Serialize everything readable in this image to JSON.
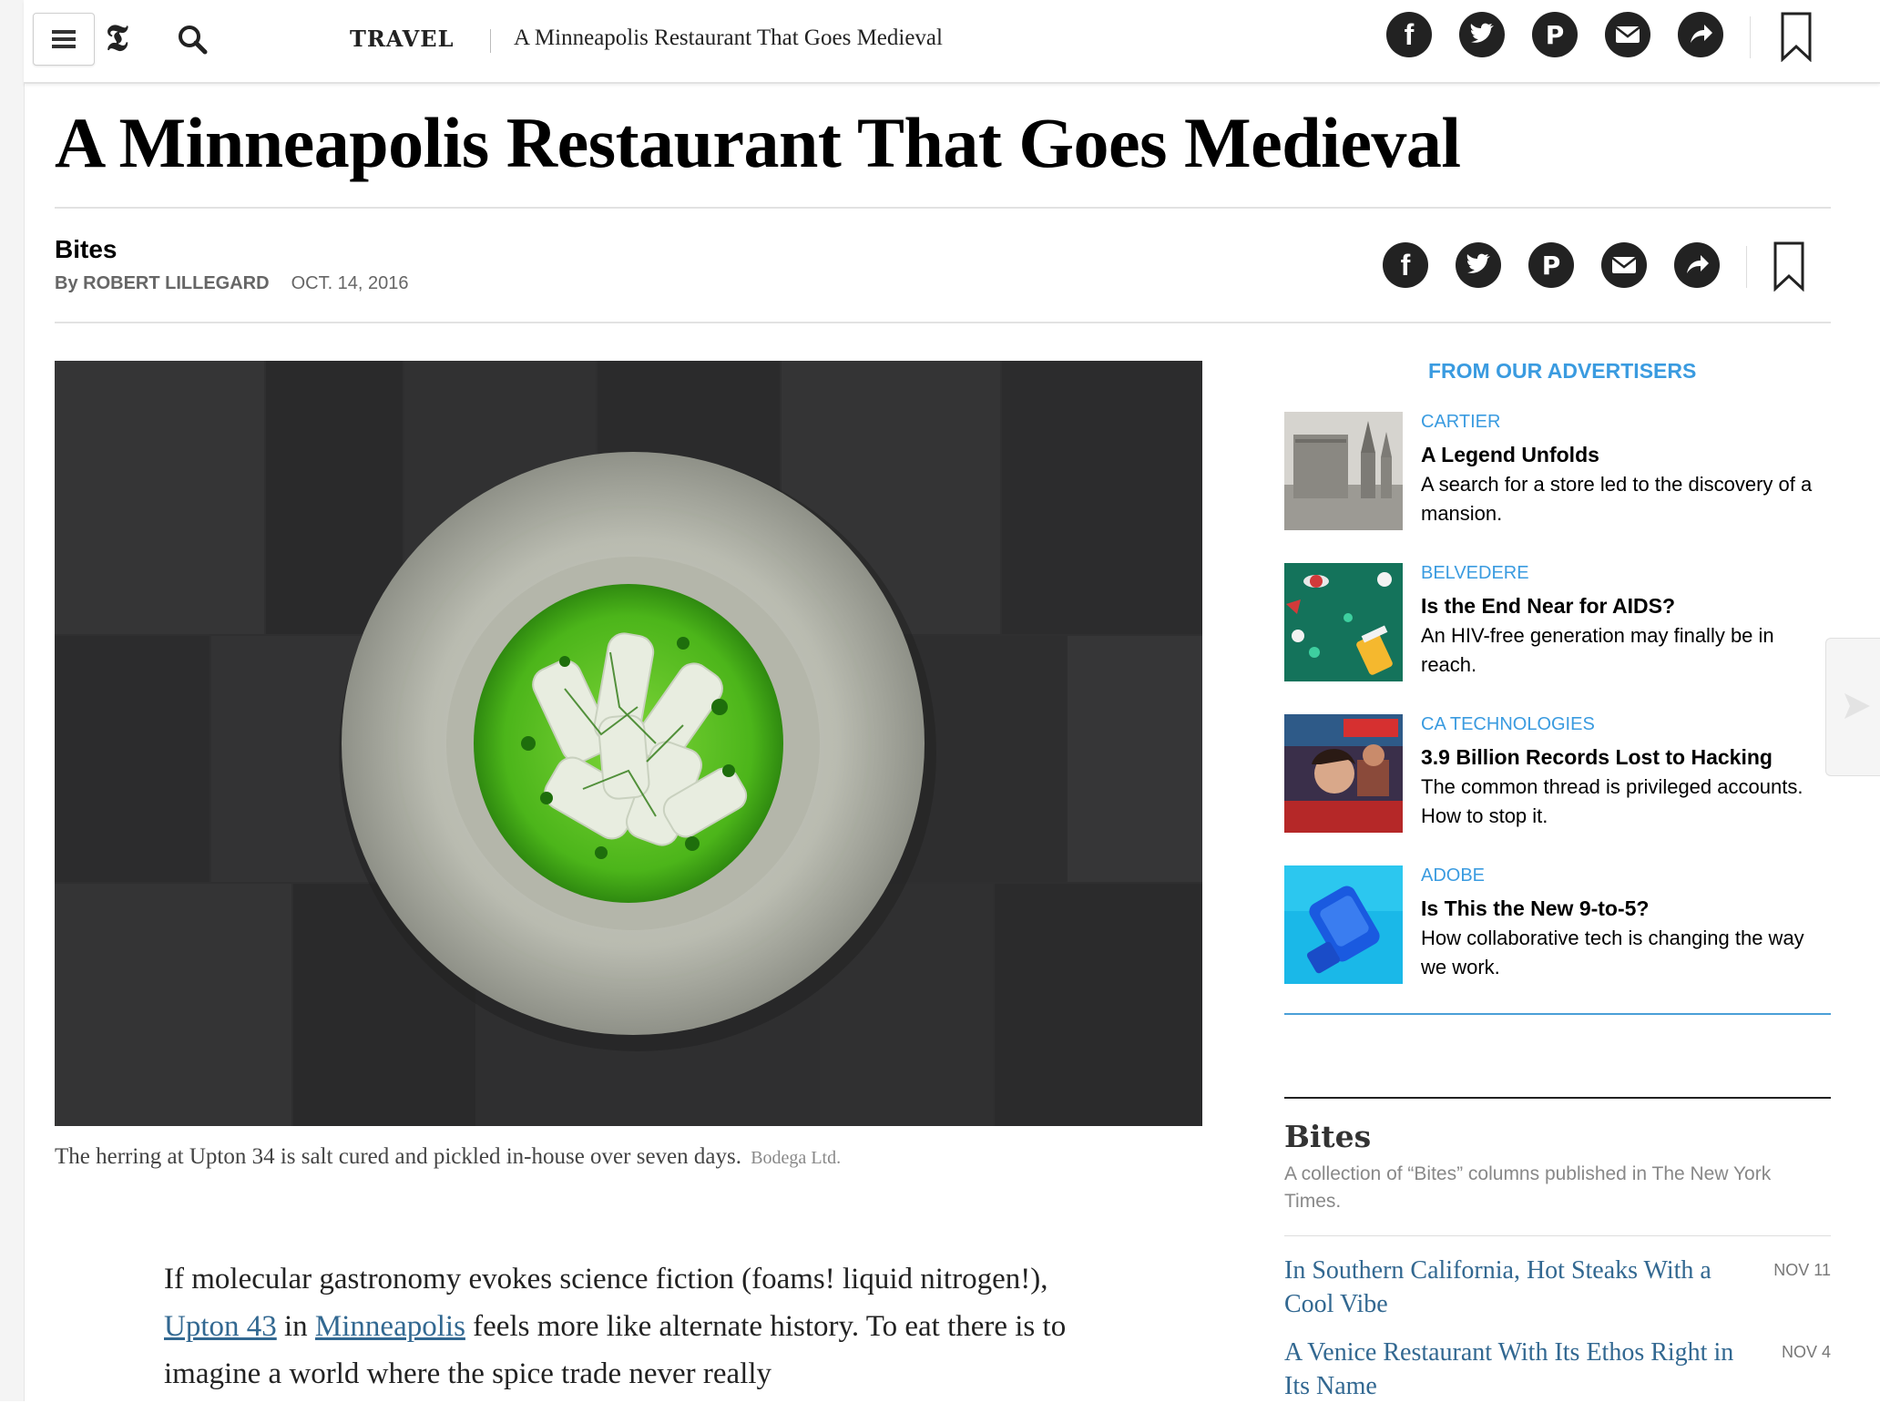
{
  "topbar": {
    "menu_icon": "hamburger-icon",
    "logo_text": "𝕿",
    "search_icon": "search-icon",
    "section": "TRAVEL",
    "title": "A Minneapolis Restaurant That Goes Medieval"
  },
  "share_icons": [
    "facebook-icon",
    "twitter-icon",
    "pinterest-icon",
    "email-icon",
    "share-icon",
    "bookmark-icon"
  ],
  "article": {
    "headline": "A Minneapolis Restaurant That Goes Medieval",
    "kicker": "Bites",
    "byline_prefix": "By ",
    "author": "ROBERT LILLEGARD",
    "date": "OCT. 14, 2016",
    "caption": "The herring at Upton 34 is salt cured and pickled in-house over seven days.",
    "credit": "Bodega Ltd.",
    "body": {
      "p1_a": "If molecular gastronomy evokes science fiction (foams! liquid nitrogen!), ",
      "link1": "Upton 43",
      "p1_b": " in ",
      "link2": "Minneapolis",
      "p1_c": " feels more like alternate history. To eat there is to imagine a world where the spice trade never really"
    }
  },
  "advertisers": {
    "title": "FROM OUR ADVERTISERS",
    "items": [
      {
        "brand": "CARTIER",
        "title": "A Legend Unfolds",
        "desc": "A search for a store led to the discovery of a mansion."
      },
      {
        "brand": "BELVEDERE",
        "title": "Is the End Near for AIDS?",
        "desc": "An HIV-free generation may finally be in reach."
      },
      {
        "brand": "CA TECHNOLOGIES",
        "title": "3.9 Billion Records Lost to Hacking",
        "desc": "The common thread is privileged accounts. How to stop it."
      },
      {
        "brand": "ADOBE",
        "title": "Is This the New 9-to-5?",
        "desc": "How collaborative tech is changing the way we work."
      }
    ]
  },
  "bites": {
    "title": "Bites",
    "desc": "A collection of “Bites” columns published in The New York Times.",
    "items": [
      {
        "title": "In Southern California, Hot Steaks With a Cool Vibe",
        "date": "NOV 11"
      },
      {
        "title": "A Venice Restaurant With Its Ethos Right in Its Name",
        "date": "NOV 4"
      }
    ]
  },
  "colors": {
    "link_blue": "#326891",
    "advertiser_blue": "#3a9be0",
    "icon_dark": "#222222"
  }
}
